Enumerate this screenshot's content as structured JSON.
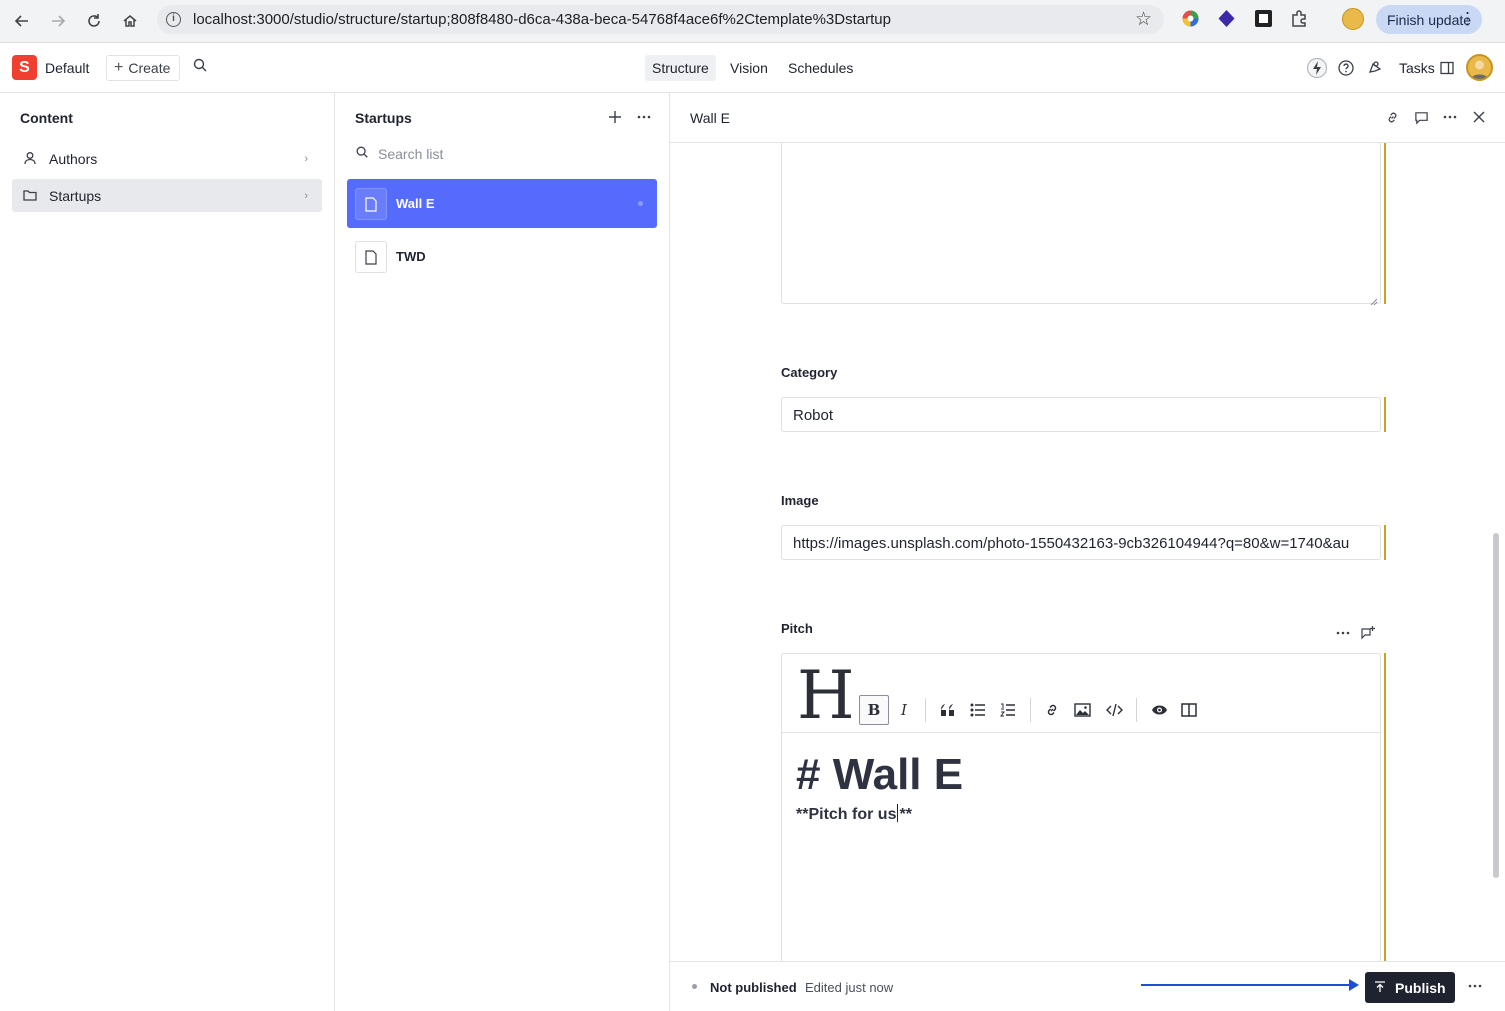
{
  "browser": {
    "url": "localhost:3000/studio/structure/startup;808f8480-d6ca-438a-beca-54768f4ace6f%2Ctemplate%3Dstartup",
    "finish_update": "Finish update"
  },
  "studio": {
    "logo_letter": "S",
    "workspace": "Default",
    "create_label": "Create",
    "tabs": [
      "Structure",
      "Vision",
      "Schedules"
    ],
    "active_tab": "Structure",
    "tasks_label": "Tasks"
  },
  "content_pane": {
    "title": "Content",
    "items": [
      {
        "label": "Authors",
        "icon": "user-icon"
      },
      {
        "label": "Startups",
        "icon": "folder-icon"
      }
    ]
  },
  "list_pane": {
    "title": "Startups",
    "search_placeholder": "Search list",
    "documents": [
      {
        "label": "Wall E",
        "selected": true
      },
      {
        "label": "TWD",
        "selected": false
      }
    ]
  },
  "editor": {
    "title": "Wall E",
    "fields": {
      "category": {
        "label": "Category",
        "value": "Robot"
      },
      "image": {
        "label": "Image",
        "value": "https://images.unsplash.com/photo-1550432163-9cb326104944?q=80&w=1740&au"
      },
      "pitch": {
        "label": "Pitch",
        "heading_line": "# Wall E",
        "body_before_cursor": "**Pitch for us",
        "body_after_cursor": "**"
      }
    },
    "toolbar": {
      "heading": "H",
      "bold": "B",
      "italic": "I"
    },
    "footer": {
      "status": "Not published",
      "edited": "Edited just now",
      "publish_label": "Publish"
    }
  },
  "colors": {
    "brand": "#f03e2f",
    "selection": "#556bfc",
    "change_indicator": "#c9a227",
    "arrow": "#1c4fd1"
  }
}
